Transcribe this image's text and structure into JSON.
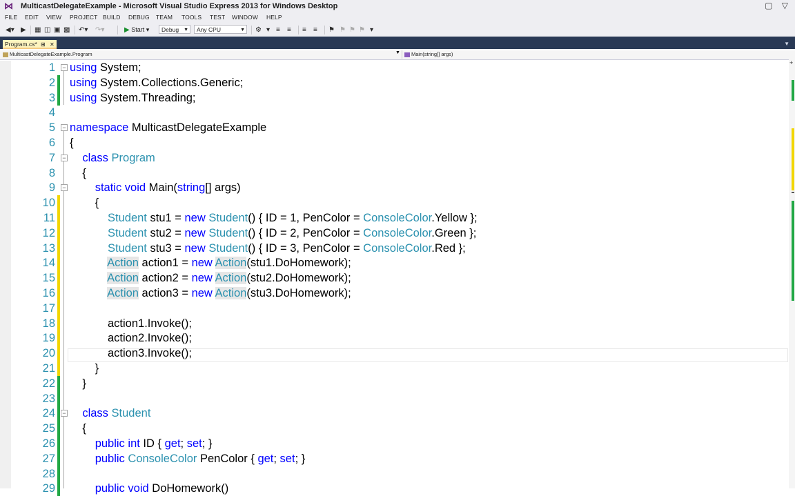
{
  "window": {
    "title": "MulticastDelegateExample - Microsoft Visual Studio Express 2013 for Windows Desktop"
  },
  "menu": [
    "FILE",
    "EDIT",
    "VIEW",
    "PROJECT",
    "BUILD",
    "DEBUG",
    "TEAM",
    "TOOLS",
    "TEST",
    "WINDOW",
    "HELP"
  ],
  "toolbar": {
    "start_label": "Start",
    "config": "Debug",
    "platform": "Any CPU"
  },
  "tab": {
    "name": "Program.cs*"
  },
  "navbar": {
    "left": "MulticastDelegateExample.Program",
    "right": "Main(string[] args)"
  },
  "colors": {
    "keyword": "#0000ff",
    "type": "#2b91af",
    "line_number": "#2b91af",
    "change_saved": "#22a845",
    "change_unsaved": "#f2d600",
    "tab_bg": "#fdf4bf",
    "chrome": "#293955"
  },
  "code_lines": [
    {
      "n": "1",
      "chg": "none",
      "fold": "minus",
      "tokens": [
        {
          "t": "using",
          "c": "kw"
        },
        {
          "t": " System;"
        }
      ]
    },
    {
      "n": "2",
      "chg": "saved",
      "fold": "",
      "tokens": [
        {
          "t": "using",
          "c": "kw"
        },
        {
          "t": " System.Collections.Generic;"
        }
      ]
    },
    {
      "n": "3",
      "chg": "saved",
      "fold": "",
      "tokens": [
        {
          "t": "using",
          "c": "kw"
        },
        {
          "t": " System.Threading;"
        }
      ]
    },
    {
      "n": "4",
      "chg": "none",
      "fold": "",
      "tokens": []
    },
    {
      "n": "5",
      "chg": "none",
      "fold": "minus",
      "tokens": [
        {
          "t": "namespace",
          "c": "kw"
        },
        {
          "t": " MulticastDelegateExample"
        }
      ]
    },
    {
      "n": "6",
      "chg": "none",
      "fold": "",
      "tokens": [
        {
          "t": "{"
        }
      ]
    },
    {
      "n": "7",
      "chg": "none",
      "fold": "minus",
      "tokens": [
        {
          "t": "    "
        },
        {
          "t": "class",
          "c": "kw"
        },
        {
          "t": " "
        },
        {
          "t": "Program",
          "c": "ty"
        }
      ]
    },
    {
      "n": "8",
      "chg": "none",
      "fold": "",
      "tokens": [
        {
          "t": "    {"
        }
      ]
    },
    {
      "n": "9",
      "chg": "none",
      "fold": "minus",
      "tokens": [
        {
          "t": "        "
        },
        {
          "t": "static",
          "c": "kw"
        },
        {
          "t": " "
        },
        {
          "t": "void",
          "c": "kw"
        },
        {
          "t": " Main("
        },
        {
          "t": "string",
          "c": "kw"
        },
        {
          "t": "[] args)"
        }
      ]
    },
    {
      "n": "10",
      "chg": "unsaved",
      "fold": "",
      "tokens": [
        {
          "t": "        {"
        }
      ]
    },
    {
      "n": "11",
      "chg": "unsaved",
      "fold": "",
      "tokens": [
        {
          "t": "            "
        },
        {
          "t": "Student",
          "c": "ty"
        },
        {
          "t": " stu1 = "
        },
        {
          "t": "new",
          "c": "kw"
        },
        {
          "t": " "
        },
        {
          "t": "Student",
          "c": "ty"
        },
        {
          "t": "() { ID = 1, PenColor = "
        },
        {
          "t": "ConsoleColor",
          "c": "ty"
        },
        {
          "t": ".Yellow };"
        }
      ]
    },
    {
      "n": "12",
      "chg": "unsaved",
      "fold": "",
      "tokens": [
        {
          "t": "            "
        },
        {
          "t": "Student",
          "c": "ty"
        },
        {
          "t": " stu2 = "
        },
        {
          "t": "new",
          "c": "kw"
        },
        {
          "t": " "
        },
        {
          "t": "Student",
          "c": "ty"
        },
        {
          "t": "() { ID = 2, PenColor = "
        },
        {
          "t": "ConsoleColor",
          "c": "ty"
        },
        {
          "t": ".Green };"
        }
      ]
    },
    {
      "n": "13",
      "chg": "unsaved",
      "fold": "",
      "tokens": [
        {
          "t": "            "
        },
        {
          "t": "Student",
          "c": "ty"
        },
        {
          "t": " stu3 = "
        },
        {
          "t": "new",
          "c": "kw"
        },
        {
          "t": " "
        },
        {
          "t": "Student",
          "c": "ty"
        },
        {
          "t": "() { ID = 3, PenColor = "
        },
        {
          "t": "ConsoleColor",
          "c": "ty"
        },
        {
          "t": ".Red };"
        }
      ]
    },
    {
      "n": "14",
      "chg": "unsaved",
      "fold": "",
      "tokens": [
        {
          "t": "            "
        },
        {
          "t": "Action",
          "c": "hl"
        },
        {
          "t": " action1 = "
        },
        {
          "t": "new",
          "c": "kw"
        },
        {
          "t": " "
        },
        {
          "t": "Action",
          "c": "hl"
        },
        {
          "t": "(stu1.DoHomework);"
        }
      ]
    },
    {
      "n": "15",
      "chg": "unsaved",
      "fold": "",
      "tokens": [
        {
          "t": "            "
        },
        {
          "t": "Action",
          "c": "hl"
        },
        {
          "t": " action2 = "
        },
        {
          "t": "new",
          "c": "kw"
        },
        {
          "t": " "
        },
        {
          "t": "Action",
          "c": "hl"
        },
        {
          "t": "(stu2.DoHomework);"
        }
      ]
    },
    {
      "n": "16",
      "chg": "unsaved",
      "fold": "",
      "tokens": [
        {
          "t": "            "
        },
        {
          "t": "Action",
          "c": "hl"
        },
        {
          "t": " action3 = "
        },
        {
          "t": "new",
          "c": "kw"
        },
        {
          "t": " "
        },
        {
          "t": "Action",
          "c": "hl"
        },
        {
          "t": "(stu3.DoHomework);"
        }
      ]
    },
    {
      "n": "17",
      "chg": "unsaved",
      "fold": "",
      "tokens": []
    },
    {
      "n": "18",
      "chg": "unsaved",
      "fold": "",
      "tokens": [
        {
          "t": "            action1.Invoke();"
        }
      ]
    },
    {
      "n": "19",
      "chg": "unsaved",
      "fold": "",
      "tokens": [
        {
          "t": "            action2.Invoke();"
        }
      ]
    },
    {
      "n": "20",
      "chg": "unsaved",
      "fold": "",
      "tokens": [
        {
          "t": "            action3.Invoke();"
        }
      ]
    },
    {
      "n": "21",
      "chg": "unsaved",
      "fold": "",
      "tokens": [
        {
          "t": "        }"
        }
      ]
    },
    {
      "n": "22",
      "chg": "saved",
      "fold": "",
      "tokens": [
        {
          "t": "    }"
        }
      ]
    },
    {
      "n": "23",
      "chg": "saved",
      "fold": "",
      "tokens": []
    },
    {
      "n": "24",
      "chg": "saved",
      "fold": "minus",
      "tokens": [
        {
          "t": "    "
        },
        {
          "t": "class",
          "c": "kw"
        },
        {
          "t": " "
        },
        {
          "t": "Student",
          "c": "ty"
        }
      ]
    },
    {
      "n": "25",
      "chg": "saved",
      "fold": "",
      "tokens": [
        {
          "t": "    {"
        }
      ]
    },
    {
      "n": "26",
      "chg": "saved",
      "fold": "",
      "tokens": [
        {
          "t": "        "
        },
        {
          "t": "public",
          "c": "kw"
        },
        {
          "t": " "
        },
        {
          "t": "int",
          "c": "kw"
        },
        {
          "t": " ID { "
        },
        {
          "t": "get",
          "c": "kw"
        },
        {
          "t": "; "
        },
        {
          "t": "set",
          "c": "kw"
        },
        {
          "t": "; }"
        }
      ]
    },
    {
      "n": "27",
      "chg": "saved",
      "fold": "",
      "tokens": [
        {
          "t": "        "
        },
        {
          "t": "public",
          "c": "kw"
        },
        {
          "t": " "
        },
        {
          "t": "ConsoleColor",
          "c": "ty"
        },
        {
          "t": " PenColor { "
        },
        {
          "t": "get",
          "c": "kw"
        },
        {
          "t": "; "
        },
        {
          "t": "set",
          "c": "kw"
        },
        {
          "t": "; }"
        }
      ]
    },
    {
      "n": "28",
      "chg": "saved",
      "fold": "",
      "tokens": []
    },
    {
      "n": "29",
      "chg": "saved",
      "fold": "",
      "tokens": [
        {
          "t": "        "
        },
        {
          "t": "public",
          "c": "kw"
        },
        {
          "t": " "
        },
        {
          "t": "void",
          "c": "kw"
        },
        {
          "t": " DoHomework()"
        }
      ]
    }
  ]
}
